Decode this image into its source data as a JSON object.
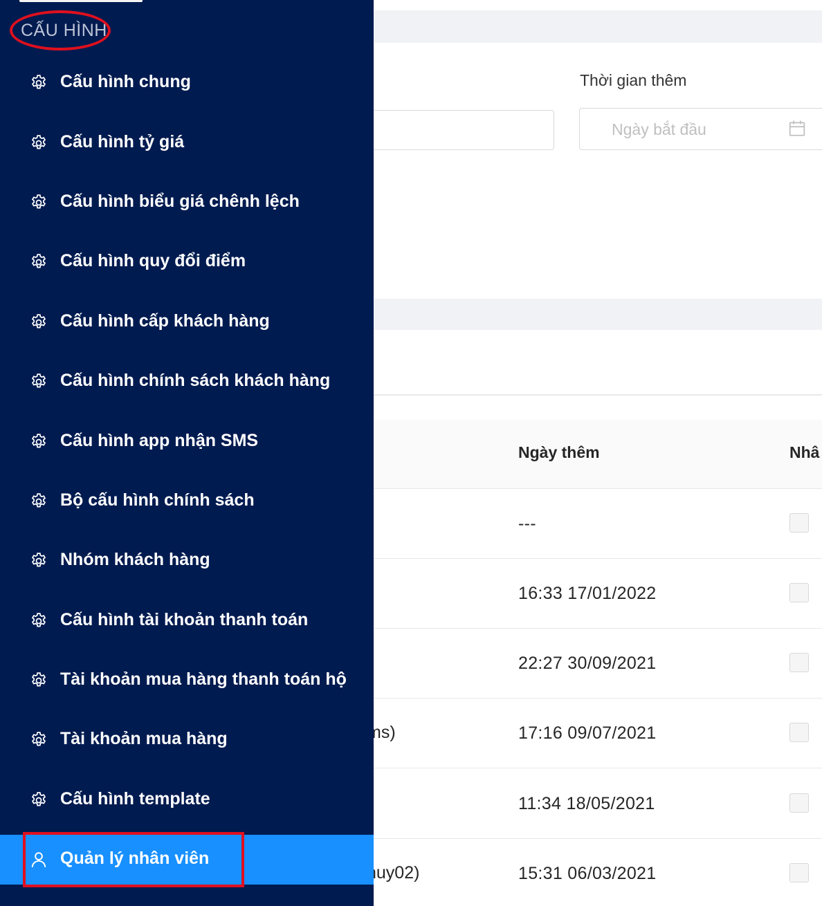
{
  "main": {
    "filter": {
      "time_label": "Thời gian thêm",
      "start_date_placeholder": "Ngày bắt đầu"
    },
    "table": {
      "columns": {
        "date_added": "Ngày thêm",
        "next_col_partial": "Nhâ"
      },
      "rows": [
        {
          "name": "",
          "date": "---"
        },
        {
          "name": "",
          "date": "16:33 17/01/2022"
        },
        {
          "name": "",
          "date": "22:27 30/09/2021"
        },
        {
          "name": "ms)",
          "date": "17:16 09/07/2021"
        },
        {
          "name": "",
          "date": "11:34 18/05/2021"
        },
        {
          "name": "huy02)",
          "date": "15:31 06/03/2021"
        }
      ]
    }
  },
  "sidebar": {
    "section_title": "CẤU HÌNH",
    "items": [
      {
        "label": "Cấu hình chung",
        "icon": "gear-icon"
      },
      {
        "label": "Cấu hình tỷ giá",
        "icon": "gear-icon"
      },
      {
        "label": "Cấu hình biểu giá chênh lệch",
        "icon": "gear-icon"
      },
      {
        "label": "Cấu hình quy đổi điểm",
        "icon": "gear-icon"
      },
      {
        "label": "Cấu hình cấp khách hàng",
        "icon": "gear-icon"
      },
      {
        "label": "Cấu hình chính sách khách hàng",
        "icon": "gear-icon"
      },
      {
        "label": "Cấu hình app nhận SMS",
        "icon": "gear-icon"
      },
      {
        "label": "Bộ cấu hình chính sách",
        "icon": "gear-icon"
      },
      {
        "label": "Nhóm khách hàng",
        "icon": "gear-icon"
      },
      {
        "label": "Cấu hình tài khoản thanh toán",
        "icon": "gear-icon"
      },
      {
        "label": "Tài khoản mua hàng thanh toán hộ",
        "icon": "gear-icon"
      },
      {
        "label": "Tài khoản mua hàng",
        "icon": "gear-icon"
      },
      {
        "label": "Cấu hình template",
        "icon": "gear-icon"
      },
      {
        "label": "Quản lý nhân viên",
        "icon": "user-icon",
        "active": true
      }
    ]
  },
  "colors": {
    "sidebar_bg": "#001b50",
    "active_item_bg": "#1890ff",
    "annotation_red": "#e0101e"
  }
}
